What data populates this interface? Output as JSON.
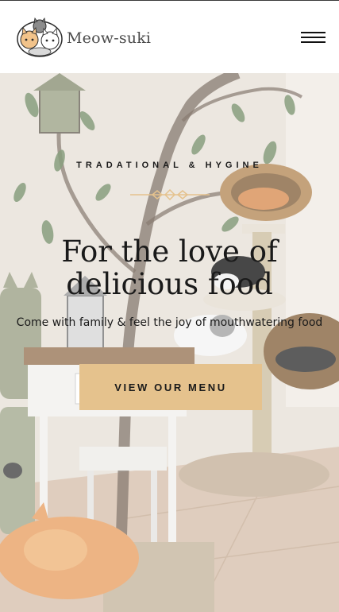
{
  "header": {
    "brand_name": "Meow-suki",
    "logo_icon": "cats-logo-icon",
    "menu_icon": "hamburger-menu-icon"
  },
  "hero": {
    "eyebrow": "TRADATIONAL & HYGINE",
    "headline_line1": "For the love of",
    "headline_line2": "delicious food",
    "subline": "Come with family & feel the joy of mouthwatering food",
    "cta_label": "VIEW OUR MENU",
    "accent_color": "#e5c28d"
  }
}
